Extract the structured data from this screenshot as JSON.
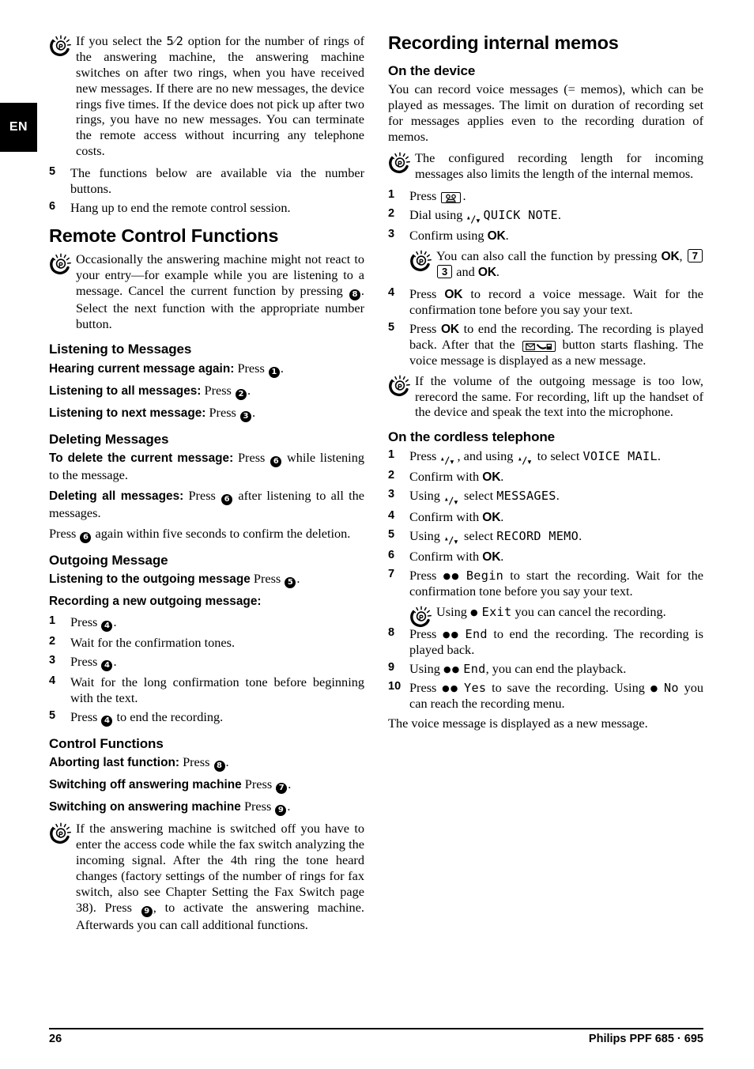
{
  "language_tab": "EN",
  "footer": {
    "page_number": "26",
    "product": "Philips PPF 685 · 695"
  },
  "left_column": {
    "tip_ring_mode": {
      "icon": "lightbulb-tip-icon",
      "text_part1": "If you select the ",
      "lcd_value": "5⁄2",
      "text_part2": " option for the number of rings of the answering machine, the answering machine switches on after two rings, when you have received new messages. If there are no new messages, the device rings five times. If the device does not pick up after two rings, you have no new messages. You can terminate the remote access without incurring any telephone costs."
    },
    "step_5": {
      "num": "5",
      "text": "The functions below are available via the number buttons."
    },
    "step_6": {
      "num": "6",
      "text": "Hang up to end the remote control session."
    },
    "heading_remote_control": "Remote Control Functions",
    "tip_remote": {
      "part1": "Occasionally the answering machine might not react to your entry—for example while you are listening to a message. Cancel the current function by pressing ",
      "circled": "8",
      "part2": ". Select the next function with the appropriate number button."
    },
    "heading_listening": "Listening to Messages",
    "listening_items": [
      {
        "lead": "Hearing current message again:",
        "text": " Press ",
        "circled": "1",
        "tail": "."
      },
      {
        "lead": "Listening to all messages:",
        "text": " Press ",
        "circled": "2",
        "tail": "."
      },
      {
        "lead": "Listening to next message:",
        "text": " Press ",
        "circled": "3",
        "tail": "."
      }
    ],
    "heading_deleting": "Deleting Messages",
    "deleting_current": {
      "lead": "To delete the current message:",
      "text": " Press ",
      "circled": "6",
      "tail": " while listening to the message."
    },
    "deleting_all": {
      "lead": "Deleting all messages:",
      "text": " Press ",
      "circled": "6",
      "tail": " after listening to all the messages."
    },
    "deleting_confirm": {
      "head": "Press ",
      "circled": "6",
      "tail": " again within five seconds to confirm the deletion."
    },
    "heading_outgoing": "Outgoing Message",
    "outgoing_listen": {
      "lead": "Listening to the outgoing message",
      "text": " Press ",
      "circled": "5",
      "tail": "."
    },
    "outgoing_record_label": "Recording a new outgoing message:",
    "outgoing_steps": [
      {
        "num": "1",
        "head": "Press ",
        "circled": "4",
        "tail": "."
      },
      {
        "num": "2",
        "head": "Wait for the confirmation tones.",
        "circled": "",
        "tail": ""
      },
      {
        "num": "3",
        "head": "Press ",
        "circled": "4",
        "tail": "."
      },
      {
        "num": "4",
        "head": "Wait for the long confirmation tone before beginning with the text.",
        "circled": "",
        "tail": ""
      },
      {
        "num": "5",
        "head": "Press ",
        "circled": "4",
        "tail": " to end the recording."
      }
    ],
    "heading_control": "Control Functions",
    "control_items": [
      {
        "lead": "Aborting last function:",
        "text": " Press ",
        "circled": "8",
        "tail": "."
      },
      {
        "lead": "Switching off answering machine",
        "text": " Press ",
        "circled": "7",
        "tail": "."
      },
      {
        "lead": "Switching on answering machine",
        "text": " Press ",
        "circled": "9",
        "tail": "."
      }
    ],
    "tip_switched_off": {
      "part1": "If the answering machine is switched off you have to enter the access code while the fax switch analyzing the incoming signal. After the 4th ring the tone heard changes (factory settings of the number of rings for fax switch, also see Chapter Setting the Fax Switch page 38). Press ",
      "circled": "9",
      "part2": ", to activate the answering machine. Afterwards you can call additional functions."
    }
  },
  "right_column": {
    "heading_main": "Recording internal memos",
    "heading_device": "On the device",
    "intro": "You can record voice messages (= memos), which can be played as messages. The limit on duration of recording set for messages applies even to the recording duration of memos.",
    "tip_length": "The configured recording length for incoming messages also limits the length of the internal memos.",
    "device_steps": [
      {
        "num": "1",
        "pre": "Press ",
        "icon": "cassette-icon",
        "post": "."
      },
      {
        "num": "2",
        "pre": "Dial using ",
        "arrows": true,
        "lcd": "QUICK NOTE",
        "post": "."
      },
      {
        "num": "3",
        "pre": "Confirm using ",
        "ok": "OK",
        "post": "."
      }
    ],
    "tip_shortcut": {
      "part1": "You can also call the function by pressing ",
      "ok1": "OK",
      "comma": ", ",
      "key1": "7",
      "key2": "3",
      "mid": " and ",
      "ok2": "OK",
      "end": "."
    },
    "device_steps_2": [
      {
        "num": "4",
        "pre": "Press ",
        "ok": "OK",
        "post": " to record a voice message. Wait for the confirmation tone before you say your text."
      },
      {
        "num": "5",
        "pre": "Press ",
        "ok": "OK",
        "mid": " to end the recording. The recording is played back. After that the ",
        "icon": "message-button-icon",
        "post": " button starts flashing. The voice message is displayed as a new message."
      }
    ],
    "tip_volume": "If the volume of the outgoing message is too low, rerecord the same. For recording, lift up the handset of the device and speak the text into the microphone.",
    "heading_cordless": "On the cordless telephone",
    "cordless_steps": [
      {
        "num": "1",
        "pre": "Press ",
        "arrows1": true,
        "mid": ", and using ",
        "arrows2": true,
        "mid2": " to select ",
        "lcd": "VOICE MAIL",
        "post": "."
      },
      {
        "num": "2",
        "pre": "Confirm with ",
        "ok": "OK",
        "post": "."
      },
      {
        "num": "3",
        "pre": "Using ",
        "arrows1": true,
        "mid2": " select ",
        "lcd": "MESSAGES",
        "post": "."
      },
      {
        "num": "4",
        "pre": "Confirm with ",
        "ok": "OK",
        "post": "."
      },
      {
        "num": "5",
        "pre": "Using ",
        "arrows1": true,
        "mid2": " select ",
        "lcd": "RECORD MEMO",
        "post": "."
      },
      {
        "num": "6",
        "pre": "Confirm with ",
        "ok": "OK",
        "post": "."
      },
      {
        "num": "7",
        "pre": "Press ",
        "dots": "●●",
        "lcd": "Begin",
        "post": " to start the recording. Wait for the confirmation tone before you say your text."
      }
    ],
    "tip_exit": {
      "part1": "Using ",
      "dots": "●",
      "lcd": "Exit",
      "part2": " you can cancel the recording."
    },
    "cordless_steps_2": [
      {
        "num": "8",
        "pre": "Press ",
        "dots": "●●",
        "lcd": "End",
        "post": " to end the recording. The recording is played back."
      },
      {
        "num": "9",
        "pre": "Using ",
        "dots": "●●",
        "lcd": "End",
        "post": ", you can end the playback."
      },
      {
        "num": "10",
        "pre": "Press ",
        "dots": "●●",
        "lcd": "Yes",
        "mid": " to save the recording. Using ",
        "dots2": "●",
        "lcd2": "No",
        "post": " you can reach the recording menu."
      }
    ],
    "closing": "The voice message is displayed as a new message."
  }
}
